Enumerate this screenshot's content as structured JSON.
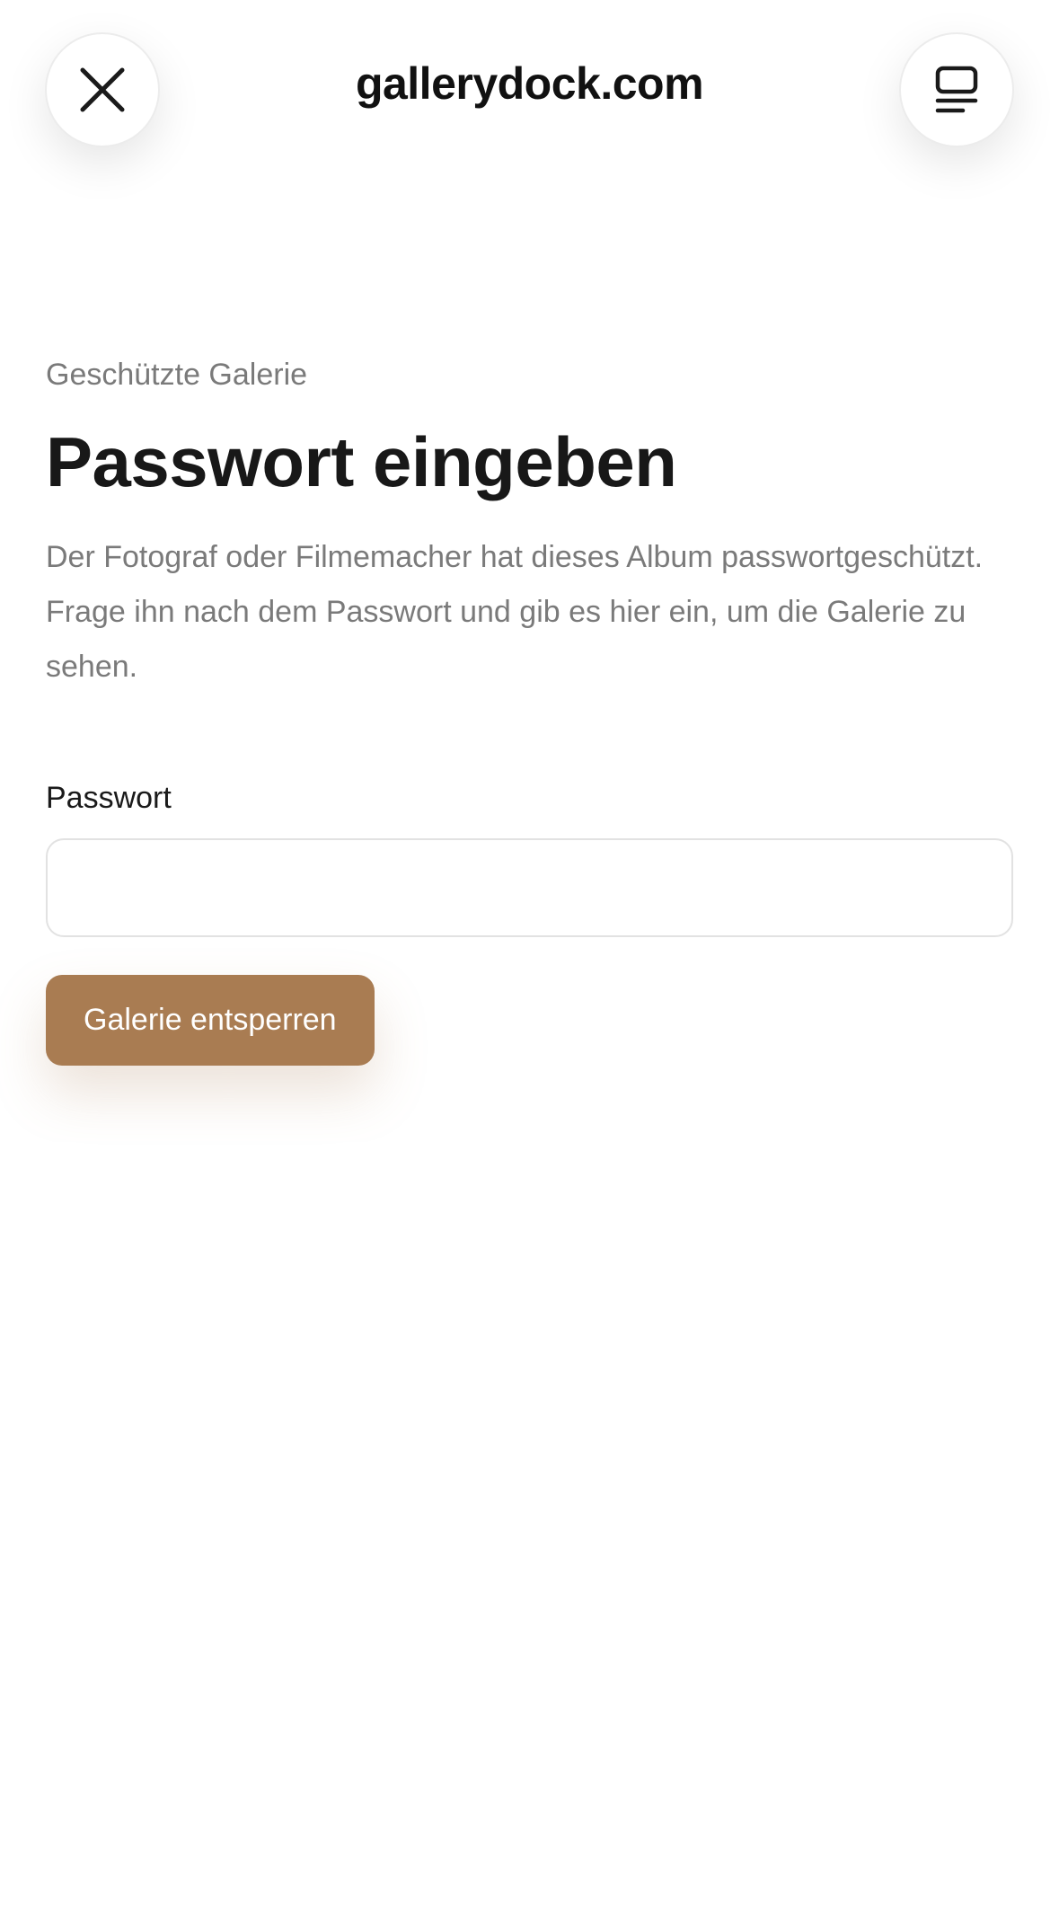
{
  "browser": {
    "domain": "gallerydock.com",
    "close_icon": "close-icon",
    "tabs_icon": "tabs-overview-icon"
  },
  "gallery": {
    "eyebrow": "Geschützte Galerie",
    "title": "Passwort eingeben",
    "description": "Der Fotograf oder Filmemacher hat dieses Album passwortgeschützt. Frage ihn nach dem Passwort und gib es hier ein, um die Galerie zu sehen.",
    "password_label": "Passwort",
    "password_value": "",
    "unlock_label": "Galerie entsperren"
  },
  "colors": {
    "accent": "#a97c52",
    "text_primary": "#181818",
    "text_secondary": "#7a7a7a"
  }
}
